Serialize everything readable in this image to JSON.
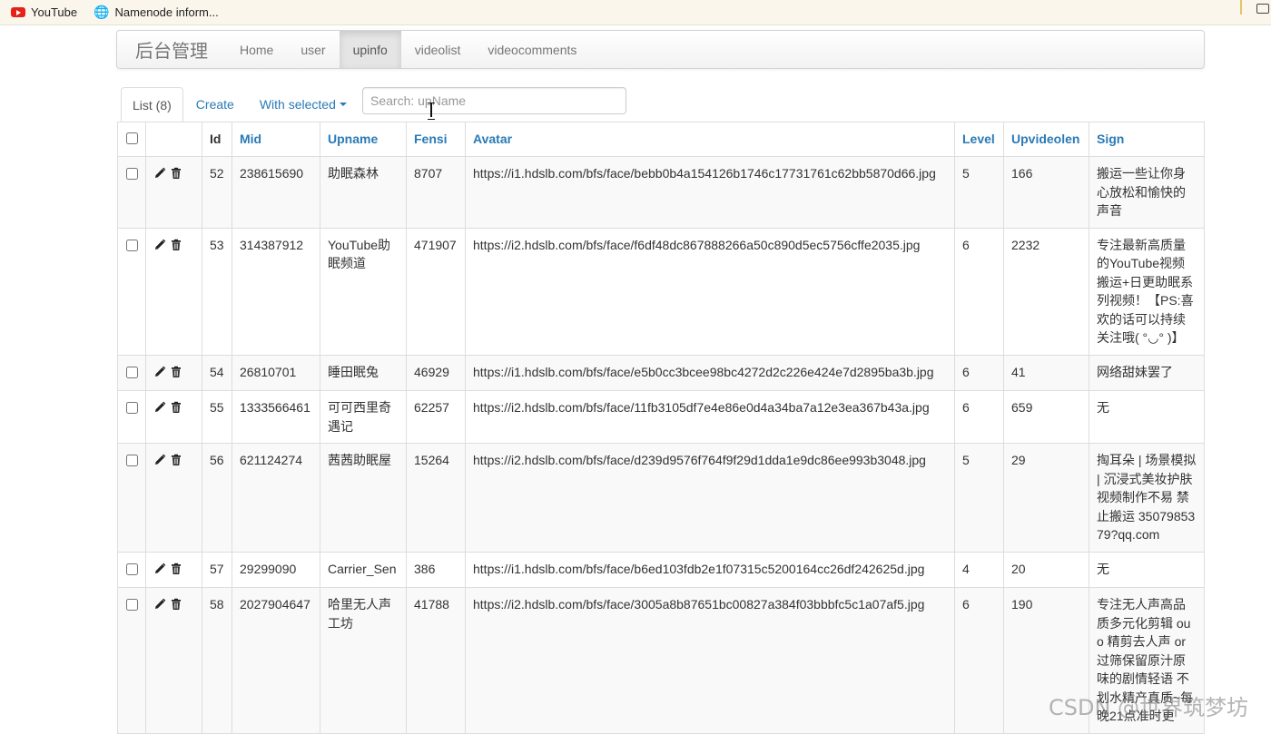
{
  "bookmarks": [
    {
      "label": "YouTube",
      "icon": "youtube-icon"
    },
    {
      "label": "Namenode inform...",
      "icon": "globe-icon"
    }
  ],
  "navbar": {
    "brand": "后台管理",
    "items": [
      {
        "label": "Home",
        "active": false
      },
      {
        "label": "user",
        "active": false
      },
      {
        "label": "upinfo",
        "active": true
      },
      {
        "label": "videolist",
        "active": false
      },
      {
        "label": "videocomments",
        "active": false
      }
    ]
  },
  "toolbar": {
    "list_label": "List (8)",
    "create_label": "Create",
    "with_selected_label": "With selected",
    "search_placeholder": "Search: upName"
  },
  "table": {
    "columns": [
      "Id",
      "Mid",
      "Upname",
      "Fensi",
      "Avatar",
      "Level",
      "Upvideolen",
      "Sign"
    ],
    "rows": [
      {
        "id": "52",
        "mid": "238615690",
        "upname": "助眠森林",
        "fensi": "8707",
        "avatar": "https://i1.hdslb.com/bfs/face/bebb0b4a154126b1746c17731761c62bb5870d66.jpg",
        "level": "5",
        "upvideolen": "166",
        "sign": "搬运一些让你身心放松和愉快的声音"
      },
      {
        "id": "53",
        "mid": "314387912",
        "upname": "YouTube助眠频道",
        "fensi": "471907",
        "avatar": "https://i2.hdslb.com/bfs/face/f6df48dc867888266a50c890d5ec5756cffe2035.jpg",
        "level": "6",
        "upvideolen": "2232",
        "sign": "专注最新高质量的YouTube视频搬运+日更助眠系列视频！【PS:喜欢的话可以持续关注哦( °◡° )】"
      },
      {
        "id": "54",
        "mid": "26810701",
        "upname": "睡田眠兔",
        "fensi": "46929",
        "avatar": "https://i1.hdslb.com/bfs/face/e5b0cc3bcee98bc4272d2c226e424e7d2895ba3b.jpg",
        "level": "6",
        "upvideolen": "41",
        "sign": "网络甜妹罢了"
      },
      {
        "id": "55",
        "mid": "1333566461",
        "upname": "可可西里奇遇记",
        "fensi": "62257",
        "avatar": "https://i2.hdslb.com/bfs/face/11fb3105df7e4e86e0d4a34ba7a12e3ea367b43a.jpg",
        "level": "6",
        "upvideolen": "659",
        "sign": "无"
      },
      {
        "id": "56",
        "mid": "621124274",
        "upname": "茜茜助眠屋",
        "fensi": "15264",
        "avatar": "https://i2.hdslb.com/bfs/face/d239d9576f764f9f29d1dda1e9dc86ee993b3048.jpg",
        "level": "5",
        "upvideolen": "29",
        "sign": "掏耳朵 | 场景模拟 | 沉浸式美妆护肤 视频制作不易 禁止搬运 3507985379?qq.com"
      },
      {
        "id": "57",
        "mid": "29299090",
        "upname": "Carrier_Sen",
        "fensi": "386",
        "avatar": "https://i1.hdslb.com/bfs/face/b6ed103fdb2e1f07315c5200164cc26df242625d.jpg",
        "level": "4",
        "upvideolen": "20",
        "sign": "无"
      },
      {
        "id": "58",
        "mid": "2027904647",
        "upname": "哈里无人声工坊",
        "fensi": "41788",
        "avatar": "https://i2.hdslb.com/bfs/face/3005a8b87651bc00827a384f03bbbfc5c1a07af5.jpg",
        "level": "6",
        "upvideolen": "190",
        "sign": "专注无人声高品质多元化剪辑 ouo 精剪去人声 or过筛保留原汁原味的剧情轻语 不划水精产真质~每晚21点准时更"
      }
    ]
  },
  "watermark": "CSDN @世界筑梦坊"
}
